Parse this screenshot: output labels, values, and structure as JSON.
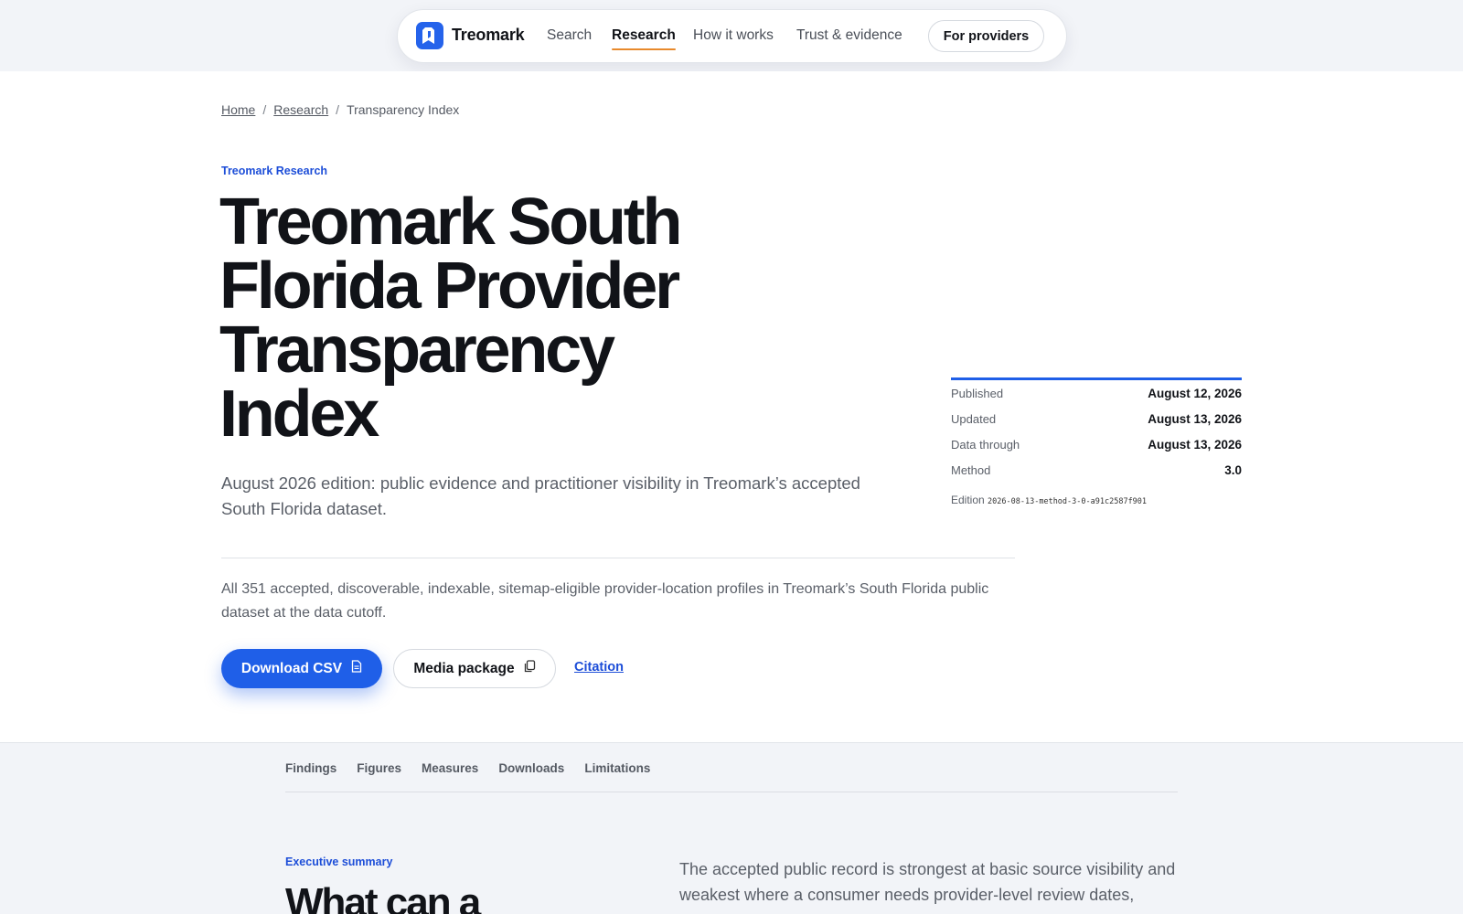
{
  "nav": {
    "logo_text": "Treomark",
    "links": [
      "Search",
      "Research",
      "How it works",
      "Trust & evidence"
    ],
    "providers_label": "For providers"
  },
  "breadcrumb": [
    "Home",
    "Research",
    "Transparency Index"
  ],
  "hero": {
    "eyebrow": "Treomark Research",
    "title_lines": [
      "Treomark South",
      "Florida Provider",
      "Transparency",
      "Index"
    ],
    "subtitle": "August 2026 edition: public evidence and practitioner visibility in Treomark’s accepted South Florida dataset.",
    "scope": "All 351 accepted, discoverable, indexable, sitemap-eligible provider-location profiles in Treomark’s South Florida public dataset at the data cutoff.",
    "download_label": "Download CSV",
    "media_label": "Media package",
    "citation_label": "Citation"
  },
  "meta": {
    "rows": [
      {
        "key": "Published",
        "value": "August 12, 2026"
      },
      {
        "key": "Updated",
        "value": "August 13, 2026"
      },
      {
        "key": "Data through",
        "value": "August 13, 2026"
      },
      {
        "key": "Method",
        "value": "3.0"
      }
    ],
    "edition_label": "Edition",
    "edition_code": "2026-08-13-method-3-0-a91c2587f901"
  },
  "tabs": [
    "Findings",
    "Figures",
    "Measures",
    "Downloads",
    "Limitations"
  ],
  "summary": {
    "eyebrow": "Executive summary",
    "title": "What can a",
    "text": "The accepted public record is strongest at basic source visibility and weakest where a consumer needs provider-level review dates,"
  },
  "colors": {
    "accent": "#1f5fe8",
    "nav_underline": "#e8892c",
    "link": "#1d4ed8"
  }
}
